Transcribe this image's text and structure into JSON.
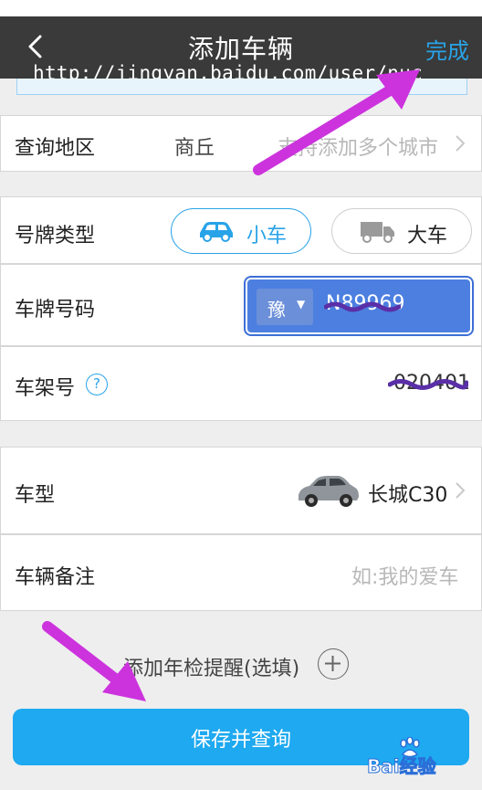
{
  "nav": {
    "title": "添加车辆",
    "done_label": "完成",
    "watermark": "http://jingyan.baidu.com/user/nuc"
  },
  "region": {
    "label": "查询地区",
    "value": "商丘",
    "hint": "支持添加多个城市"
  },
  "plate_type": {
    "label": "号牌类型",
    "options": [
      "小车",
      "大车"
    ],
    "selected": "小车"
  },
  "plate_number": {
    "label": "车牌号码",
    "province": "豫",
    "value": "N89969"
  },
  "frame_number": {
    "label": "车架号",
    "help_symbol": "?",
    "value": "020401"
  },
  "model": {
    "label": "车型",
    "value": "长城C30"
  },
  "remark": {
    "label": "车辆备注",
    "placeholder": "如:我的爱车"
  },
  "reminder": {
    "label": "添加年检提醒(选填)"
  },
  "save_button": {
    "label": "保存并查询"
  },
  "brand_logo": {
    "text": "Bai经验"
  },
  "colors": {
    "nav_bg": "#3a3a3a",
    "accent": "#29a3e8",
    "button": "#1ea9f0",
    "annotation_arrow": "#cc33dd",
    "plate_highlight": "#4c7fe0"
  }
}
